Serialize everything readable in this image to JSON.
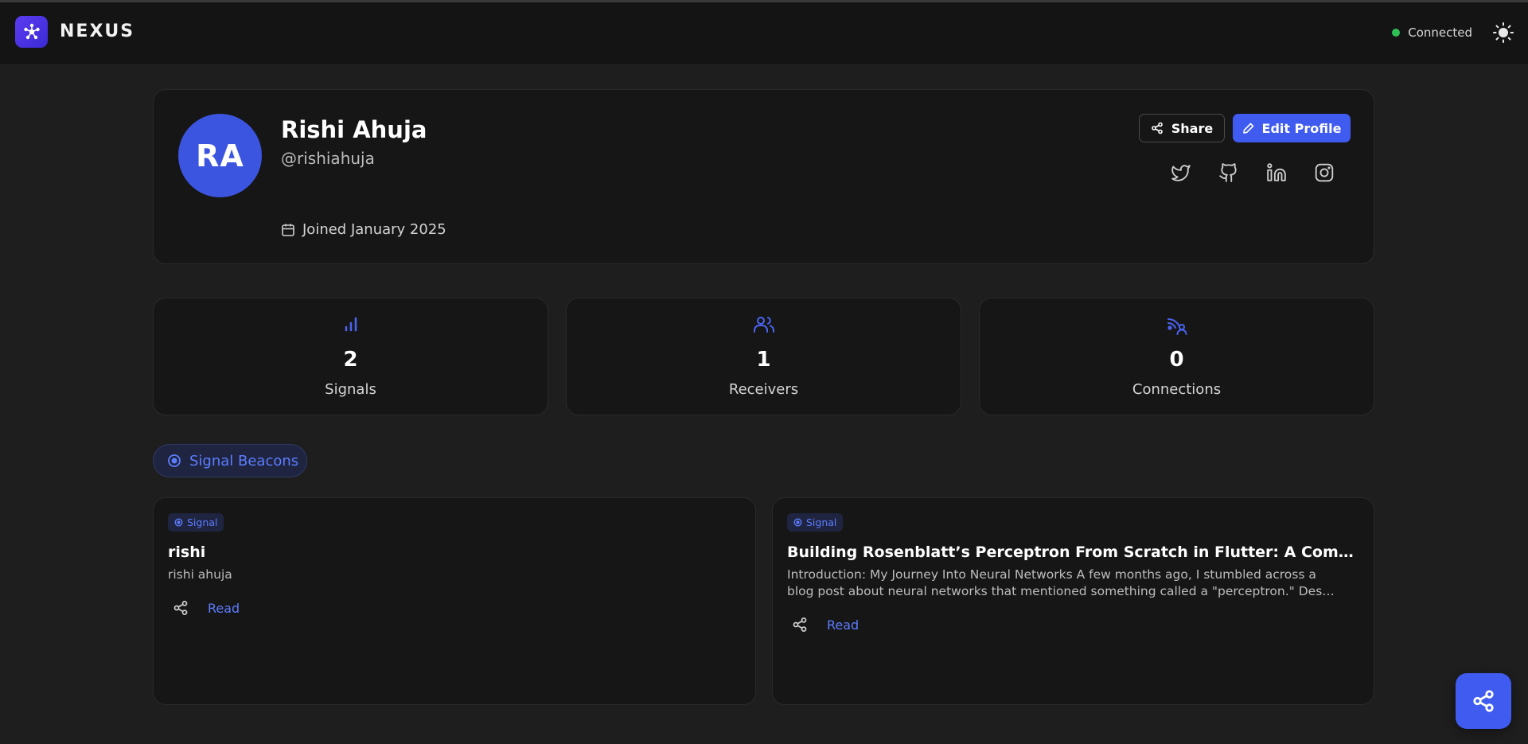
{
  "header": {
    "brand": "NEXUS",
    "status": "Connected",
    "status_color": "#2fbf55"
  },
  "profile": {
    "initials": "RA",
    "name": "Rishi Ahuja",
    "handle": "@rishiahuja",
    "joined": "Joined January 2025",
    "share_label": "Share",
    "edit_label": "Edit Profile",
    "social": [
      "twitter-icon",
      "github-icon",
      "linkedin-icon",
      "instagram-icon"
    ]
  },
  "stats": [
    {
      "icon": "bar-chart-icon",
      "value": "2",
      "label": "Signals"
    },
    {
      "icon": "users-icon",
      "value": "1",
      "label": "Receivers"
    },
    {
      "icon": "signal-connections-icon",
      "value": "0",
      "label": "Connections"
    }
  ],
  "tab": {
    "label": "Signal Beacons"
  },
  "posts": [
    {
      "badge": "Signal",
      "title": "rishi",
      "excerpt": [
        "rishi ahuja"
      ],
      "read_label": "Read"
    },
    {
      "badge": "Signal",
      "title": "Building Rosenblatt’s Perceptron From Scratch in Flutter: A Comprehensive …",
      "excerpt": [
        "Introduction: My Journey Into Neural Networks A few months ago, I stumbled across a",
        "blog post about neural networks that mentioned something called a \"perceptron.\" Des…"
      ],
      "read_label": "Read"
    }
  ],
  "colors": {
    "accent": "#3f5bf0",
    "accent_text": "#5c7cff",
    "background": "#1e1e1e",
    "card": "#161616"
  }
}
